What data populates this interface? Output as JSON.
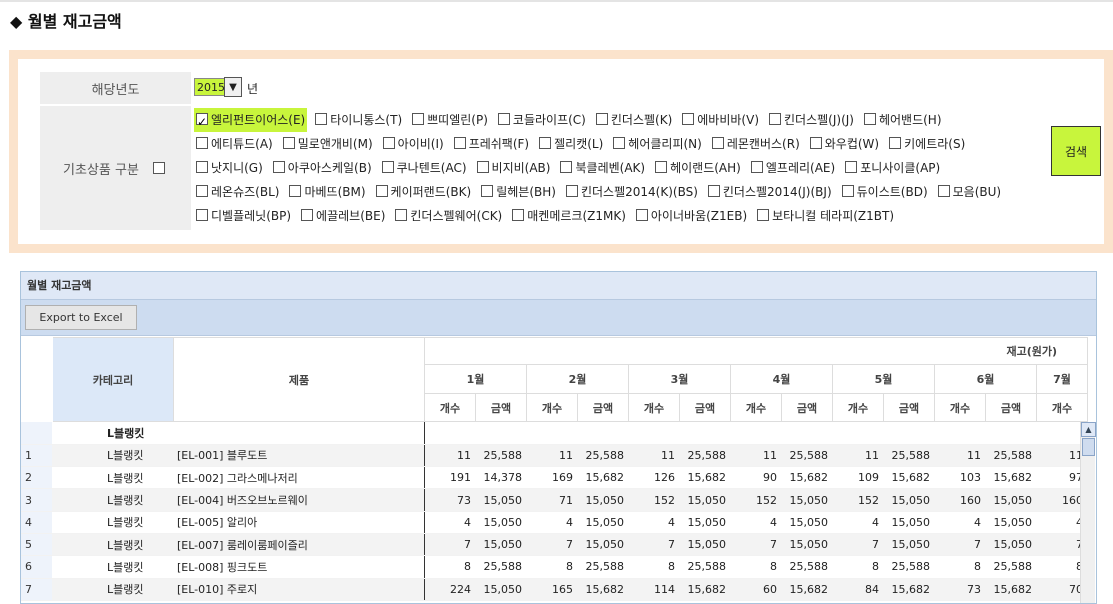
{
  "page": {
    "title": "◆ 월별 재고금액"
  },
  "filter": {
    "year_label": "해당년도",
    "year_value": "2015",
    "year_unit": "년",
    "category_label": "기초상품 구분",
    "search_label": "검색",
    "brand_rows": [
      [
        {
          "label": "엘리펀트이어스(E)",
          "checked": true
        },
        {
          "label": "타이니통스(T)",
          "checked": false
        },
        {
          "label": "쁘띠엘린(P)",
          "checked": false
        },
        {
          "label": "코들라이프(C)",
          "checked": false
        },
        {
          "label": "킨더스펠(K)",
          "checked": false
        },
        {
          "label": "에바비바(V)",
          "checked": false
        },
        {
          "label": "킨더스펠(J)(J)",
          "checked": false
        },
        {
          "label": "헤어밴드(H)",
          "checked": false
        }
      ],
      [
        {
          "label": "에티튜드(A)",
          "checked": false
        },
        {
          "label": "밀로앤개비(M)",
          "checked": false
        },
        {
          "label": "아이비(I)",
          "checked": false
        },
        {
          "label": "프레쉬팩(F)",
          "checked": false
        },
        {
          "label": "젤리캣(L)",
          "checked": false
        },
        {
          "label": "헤어클리피(N)",
          "checked": false
        },
        {
          "label": "레몬캔버스(R)",
          "checked": false
        },
        {
          "label": "와우컵(W)",
          "checked": false
        },
        {
          "label": "키에트라(S)",
          "checked": false
        }
      ],
      [
        {
          "label": "낫지니(G)",
          "checked": false
        },
        {
          "label": "아쿠아스케일(B)",
          "checked": false
        },
        {
          "label": "쿠나텐트(AC)",
          "checked": false
        },
        {
          "label": "비지비(AB)",
          "checked": false
        },
        {
          "label": "북클레벤(AK)",
          "checked": false
        },
        {
          "label": "헤이랜드(AH)",
          "checked": false
        },
        {
          "label": "엘프레리(AE)",
          "checked": false
        },
        {
          "label": "포니사이클(AP)",
          "checked": false
        }
      ],
      [
        {
          "label": "레온슈즈(BL)",
          "checked": false
        },
        {
          "label": "마베뜨(BM)",
          "checked": false
        },
        {
          "label": "케이퍼랜드(BK)",
          "checked": false
        },
        {
          "label": "릴헤븐(BH)",
          "checked": false
        },
        {
          "label": "킨더스펠2014(K)(BS)",
          "checked": false
        },
        {
          "label": "킨더스펠2014(J)(BJ)",
          "checked": false
        },
        {
          "label": "듀이스트(BD)",
          "checked": false
        },
        {
          "label": "모음(BU)",
          "checked": false
        }
      ],
      [
        {
          "label": "디벨플레닛(BP)",
          "checked": false
        },
        {
          "label": "에끌레브(BE)",
          "checked": false
        },
        {
          "label": "킨더스펠웨어(CK)",
          "checked": false
        },
        {
          "label": "매켄메르크(Z1MK)",
          "checked": false
        },
        {
          "label": "아이너바움(Z1EB)",
          "checked": false
        },
        {
          "label": "보타니컬 테라피(Z1BT)",
          "checked": false
        }
      ]
    ]
  },
  "grid": {
    "title": "월별 재고금액",
    "export_label": "Export to Excel",
    "col_category": "카테고리",
    "col_product": "제품",
    "group_title": "재고(원가)",
    "months": [
      "1월",
      "2월",
      "3월",
      "4월",
      "5월",
      "6월",
      "7월"
    ],
    "sub_count": "개수",
    "sub_amount": "금액",
    "group_row": "L블랭킷",
    "rows": [
      {
        "no": "1",
        "cat": "L블랭킷",
        "product": "[EL-001] 블루도트",
        "vals": [
          "11",
          "25,588",
          "11",
          "25,588",
          "11",
          "25,588",
          "11",
          "25,588",
          "11",
          "25,588",
          "11",
          "25,588",
          "11"
        ]
      },
      {
        "no": "2",
        "cat": "L블랭킷",
        "product": "[EL-002] 그라스메나저리",
        "vals": [
          "191",
          "14,378",
          "169",
          "15,682",
          "126",
          "15,682",
          "90",
          "15,682",
          "109",
          "15,682",
          "103",
          "15,682",
          "97"
        ]
      },
      {
        "no": "3",
        "cat": "L블랭킷",
        "product": "[EL-004] 버즈오브노르웨이",
        "vals": [
          "73",
          "15,050",
          "71",
          "15,050",
          "152",
          "15,050",
          "152",
          "15,050",
          "152",
          "15,050",
          "160",
          "15,050",
          "160"
        ]
      },
      {
        "no": "4",
        "cat": "L블랭킷",
        "product": "[EL-005] 알리아",
        "vals": [
          "4",
          "15,050",
          "4",
          "15,050",
          "4",
          "15,050",
          "4",
          "15,050",
          "4",
          "15,050",
          "4",
          "15,050",
          "4"
        ]
      },
      {
        "no": "5",
        "cat": "L블랭킷",
        "product": "[EL-007] 룸레이룸페이즐리",
        "vals": [
          "7",
          "15,050",
          "7",
          "15,050",
          "7",
          "15,050",
          "7",
          "15,050",
          "7",
          "15,050",
          "7",
          "15,050",
          "7"
        ]
      },
      {
        "no": "6",
        "cat": "L블랭킷",
        "product": "[EL-008] 핑크도트",
        "vals": [
          "8",
          "25,588",
          "8",
          "25,588",
          "8",
          "25,588",
          "8",
          "25,588",
          "8",
          "25,588",
          "8",
          "25,588",
          "8"
        ]
      },
      {
        "no": "7",
        "cat": "L블랭킷",
        "product": "[EL-010] 주로지",
        "vals": [
          "224",
          "15,050",
          "165",
          "15,682",
          "114",
          "15,682",
          "60",
          "15,682",
          "84",
          "15,682",
          "73",
          "15,682",
          "70"
        ]
      }
    ]
  }
}
